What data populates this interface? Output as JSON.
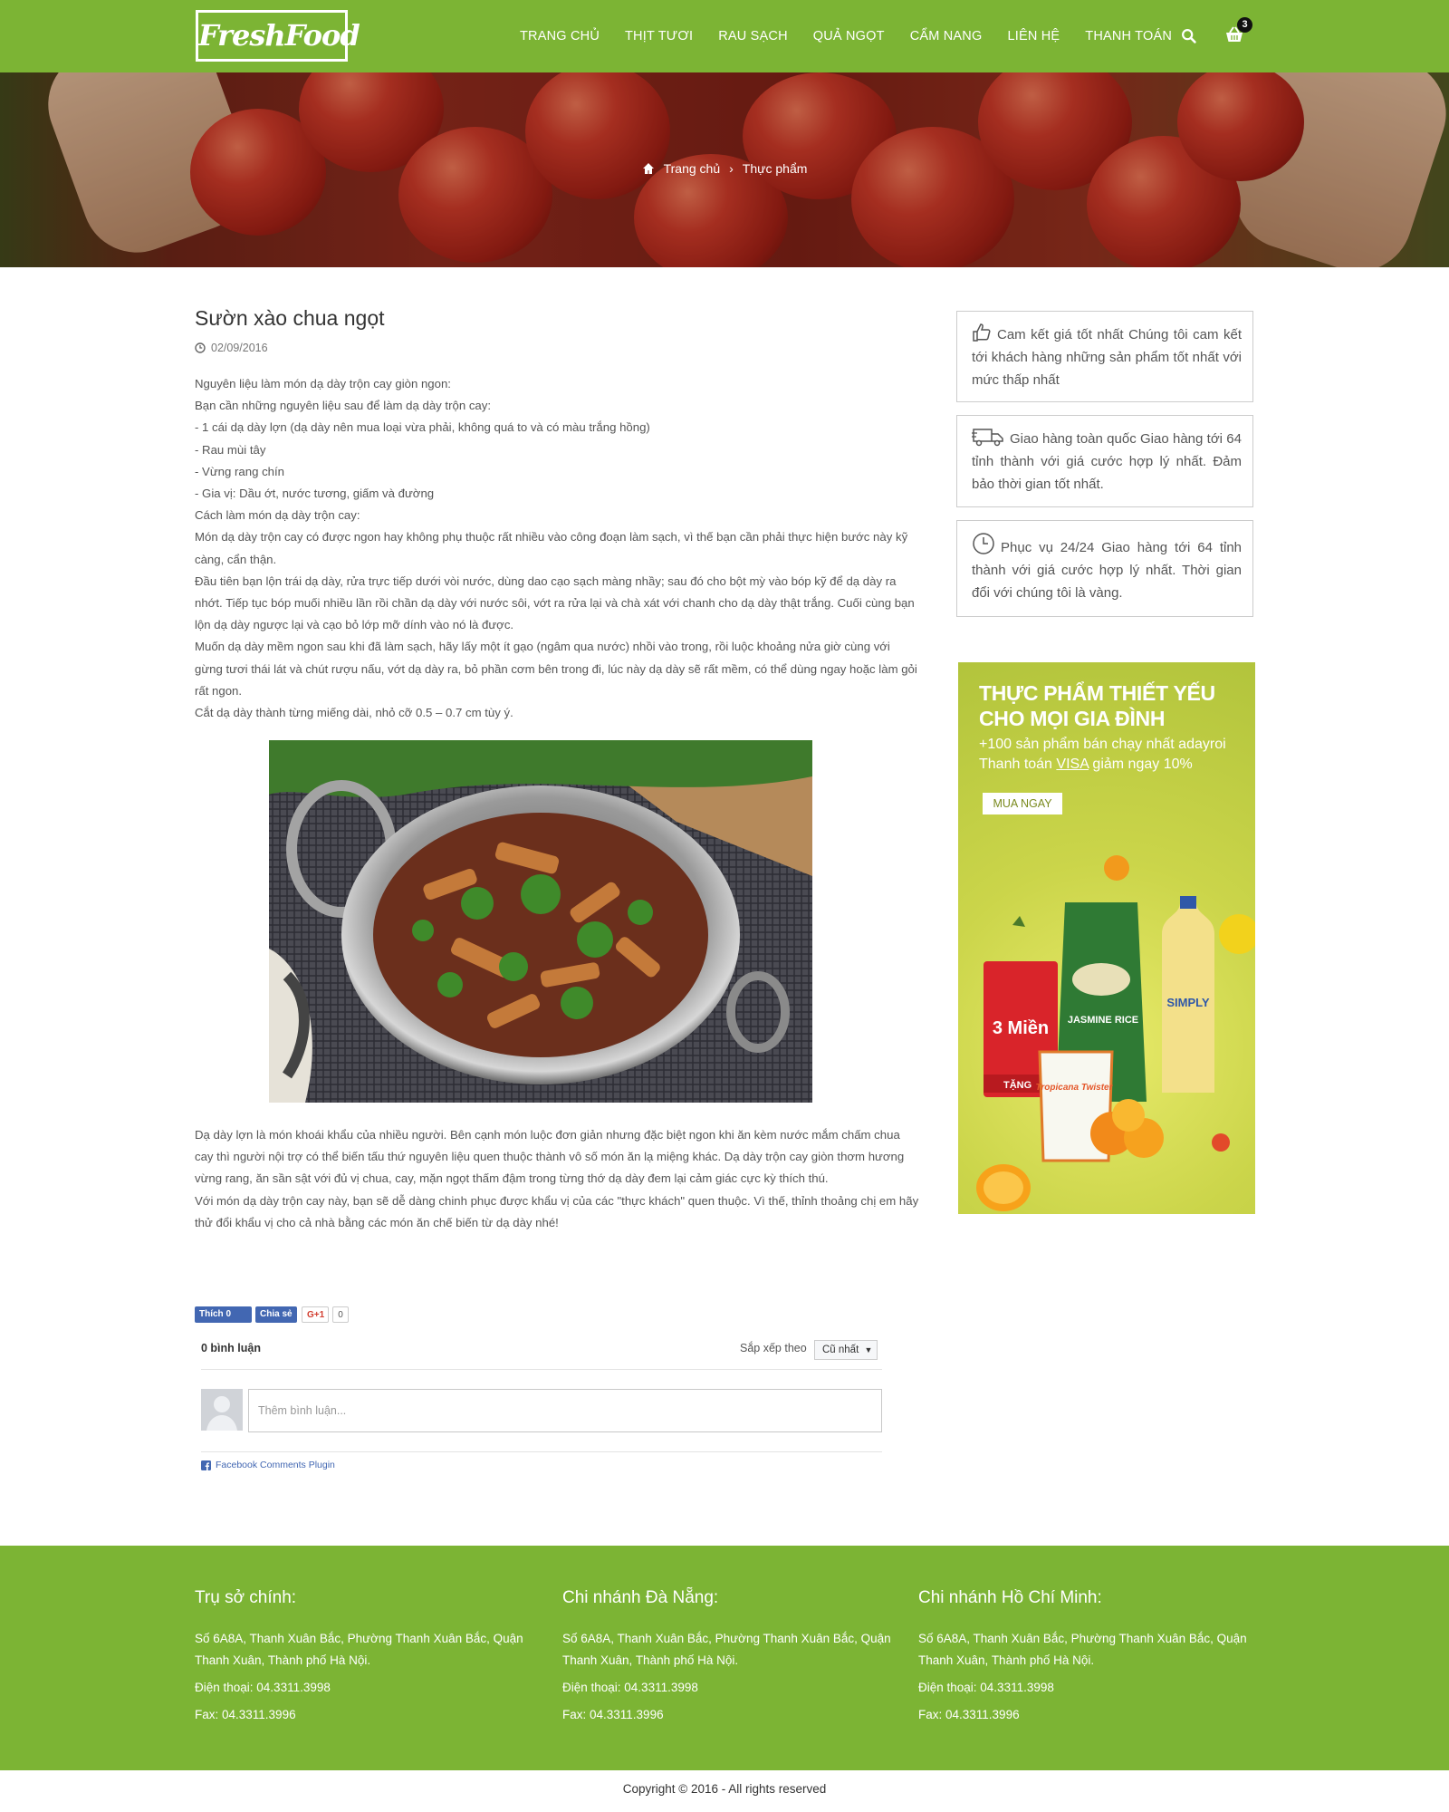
{
  "header": {
    "logo": "FreshFood",
    "nav": [
      "TRANG CHỦ",
      "THỊT TƯƠI",
      "RAU SẠCH",
      "QUẢ NGỌT",
      "CẨM NANG",
      "LIÊN HỆ",
      "THANH TOÁN"
    ],
    "cart_count": "3",
    "colors": {
      "brand_green": "#7cb434"
    }
  },
  "breadcrumb": {
    "home": "Trang chủ",
    "separator": "›",
    "current": "Thực phẩm"
  },
  "article": {
    "title": "Sườn xào chua ngọt",
    "date": "02/09/2016",
    "paragraphs": [
      "Nguyên liệu làm món dạ dày trộn cay giòn ngon:",
      "Bạn cần những nguyên liệu sau để làm dạ dày trộn cay:",
      "- 1 cái dạ dày lợn (dạ dày nên mua loại vừa phải, không quá to và có màu trắng hồng)",
      "- Rau mùi tây",
      "- Vừng rang chín",
      "- Gia vị: Dầu ớt, nước tương, giấm và đường",
      "Cách làm món dạ dày trộn cay:",
      "Món dạ dày trộn cay có được ngon hay không phụ thuộc rất nhiều vào công đoạn làm sạch, vì thế bạn cần phải thực hiện bước này kỹ càng, cẩn thận.",
      "Đầu tiên bạn lộn trái dạ dày, rửa trực tiếp dưới vòi nước, dùng dao cạo sạch màng nhầy; sau đó cho bột mỳ vào bóp kỹ để dạ dày ra nhớt. Tiếp tục bóp muối nhiều lần rồi chần dạ dày với nước sôi, vớt ra rửa lại và chà xát với chanh cho dạ dày thật trắng. Cuối cùng bạn lộn dạ dày ngược lại và cạo bỏ lớp mỡ dính vào nó là được.",
      "Muốn dạ dày mềm ngon sau khi đã làm sạch, hãy lấy một ít gạo (ngâm qua nước) nhồi vào trong, rồi luộc khoảng nửa giờ cùng với gừng tươi thái lát và chút rượu nấu, vớt dạ dày ra, bỏ phần cơm bên trong đi, lúc này dạ dày sẽ rất mềm, có thể dùng ngay hoặc làm gỏi rất ngon.",
      "Cắt dạ dày thành từng miếng dài, nhỏ cỡ 0.5 – 0.7 cm tùy ý."
    ],
    "paragraphs_after": [
      "Dạ dày lợn là món khoái khẩu của nhiều người. Bên cạnh món luộc đơn giản nhưng đặc biệt ngon khi ăn kèm nước mắm chấm chua cay thì người nội trợ có thể biến tấu thứ nguyên liệu quen thuộc thành vô số món ăn lạ miệng khác. Dạ dày trộn cay giòn thơm hương vừng rang, ăn sần sật với đủ vị chua, cay, mặn ngọt thấm đậm trong từng thớ dạ dày đem lại cảm giác cực kỳ thích thú.",
      "Với món dạ dày trộn cay này, bạn sẽ dễ dàng chinh phục được khẩu vị của các \"thực khách\" quen thuộc. Vì thế, thỉnh thoảng chị em hãy thử đổi khẩu vị cho cả nhà bằng các món ăn chế biến từ dạ dày nhé!"
    ]
  },
  "social": {
    "like": "Thích 0",
    "share": "Chia sẻ",
    "gplus": "G+1",
    "gplus_count": "0"
  },
  "comments": {
    "count_label": "0 bình luận",
    "sort_label": "Sắp xếp theo",
    "sort_value": "Cũ nhất",
    "placeholder": "Thêm bình luận...",
    "plugin_label": "Facebook Comments Plugin"
  },
  "sidebar": {
    "services": [
      {
        "icon": "thumbs-up-icon",
        "text": "Cam kết giá tốt nhất Chúng tôi cam kết tới khách hàng những sản phẩm tốt nhất với mức thấp nhất"
      },
      {
        "icon": "truck-icon",
        "text": "Giao hàng toàn quốc Giao hàng tới 64 tỉnh thành với giá cước hợp lý nhất. Đảm bảo thời gian tốt nhất."
      },
      {
        "icon": "clock-icon",
        "text": "Phục vụ 24/24 Giao hàng tới 64 tỉnh thành với giá cước hợp lý nhất. Thời gian đổi với chúng tôi là vàng."
      }
    ],
    "ad": {
      "heading": "THỰC PHẨM THIẾT YẾU CHO MỌI GIA ĐÌNH",
      "line1": "+100 sản phẩm bán chạy nhất adayroi",
      "line2_prefix": "Thanh toán ",
      "line2_visa": "VISA",
      "line2_suffix": " giảm ngay 10%",
      "button": "MUA NGAY",
      "product_labels": [
        "3 Miền",
        "JASMINE RICE",
        "SIMPLY",
        "Tropicana Twister",
        "TẶNG"
      ]
    }
  },
  "footer": {
    "columns": [
      {
        "title": "Trụ sở chính:",
        "address": "Số 6A8A, Thanh Xuân Bắc, Phường Thanh Xuân Bắc, Quận Thanh Xuân, Thành phố Hà Nội.",
        "phone": "Điện thoại: 04.3311.3998",
        "fax": "Fax: 04.3311.3996"
      },
      {
        "title": "Chi nhánh Đà Nẵng:",
        "address": "Số 6A8A, Thanh Xuân Bắc, Phường Thanh Xuân Bắc, Quận Thanh Xuân, Thành phố Hà Nội.",
        "phone": "Điện thoại: 04.3311.3998",
        "fax": "Fax: 04.3311.3996"
      },
      {
        "title": "Chi nhánh Hồ Chí Minh:",
        "address": "Số 6A8A, Thanh Xuân Bắc, Phường Thanh Xuân Bắc, Quận Thanh Xuân, Thành phố Hà Nội.",
        "phone": "Điện thoại: 04.3311.3998",
        "fax": "Fax: 04.3311.3996"
      }
    ],
    "copyright": "Copyright © 2016 - All rights reserved"
  }
}
